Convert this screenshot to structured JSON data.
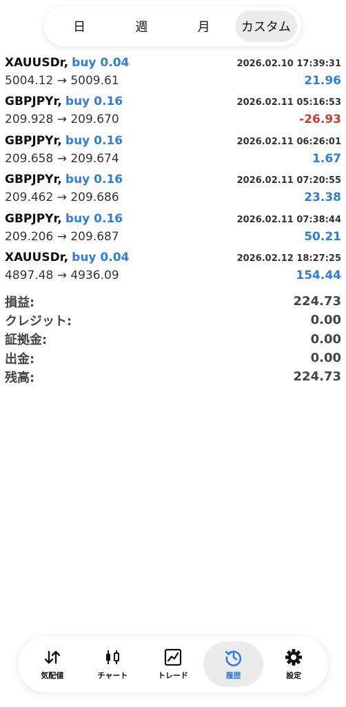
{
  "period_tabs": [
    {
      "label": "日",
      "active": false
    },
    {
      "label": "週",
      "active": false
    },
    {
      "label": "月",
      "active": false
    },
    {
      "label": "カスタム",
      "active": true
    }
  ],
  "deals": [
    {
      "symbol": "XAUUSDr,",
      "side": "buy 0.04",
      "time": "2026.02.10 17:39:31",
      "prices": "5004.12 → 5009.61",
      "profit": "21.96",
      "profit_sign": "pos"
    },
    {
      "symbol": "GBPJPYr,",
      "side": "buy 0.16",
      "time": "2026.02.11 05:16:53",
      "prices": "209.928 → 209.670",
      "profit": "-26.93",
      "profit_sign": "neg"
    },
    {
      "symbol": "GBPJPYr,",
      "side": "buy 0.16",
      "time": "2026.02.11 06:26:01",
      "prices": "209.658 → 209.674",
      "profit": "1.67",
      "profit_sign": "pos"
    },
    {
      "symbol": "GBPJPYr,",
      "side": "buy 0.16",
      "time": "2026.02.11 07:20:55",
      "prices": "209.462 → 209.686",
      "profit": "23.38",
      "profit_sign": "pos"
    },
    {
      "symbol": "GBPJPYr,",
      "side": "buy 0.16",
      "time": "2026.02.11 07:38:44",
      "prices": "209.206 → 209.687",
      "profit": "50.21",
      "profit_sign": "pos"
    },
    {
      "symbol": "XAUUSDr,",
      "side": "buy 0.04",
      "time": "2026.02.12 18:27:25",
      "prices": "4897.48 → 4936.09",
      "profit": "154.44",
      "profit_sign": "pos"
    }
  ],
  "summary": [
    {
      "label": "損益:",
      "value": "224.73"
    },
    {
      "label": "クレジット:",
      "value": "0.00"
    },
    {
      "label": "証拠金:",
      "value": "0.00"
    },
    {
      "label": "出金:",
      "value": "0.00"
    },
    {
      "label": "残高:",
      "value": "224.73"
    }
  ],
  "nav": [
    {
      "label": "気配値",
      "icon": "quotes-arrows-icon",
      "active": false
    },
    {
      "label": "チャート",
      "icon": "candlestick-chart-icon",
      "active": false
    },
    {
      "label": "トレード",
      "icon": "trade-chart-icon",
      "active": false
    },
    {
      "label": "履歴",
      "icon": "history-icon",
      "active": true
    },
    {
      "label": "設定",
      "icon": "gear-icon",
      "active": false
    }
  ],
  "colors": {
    "accent": "#2f7de1",
    "loss": "#d33a2c",
    "active_bg": "#ececec"
  }
}
